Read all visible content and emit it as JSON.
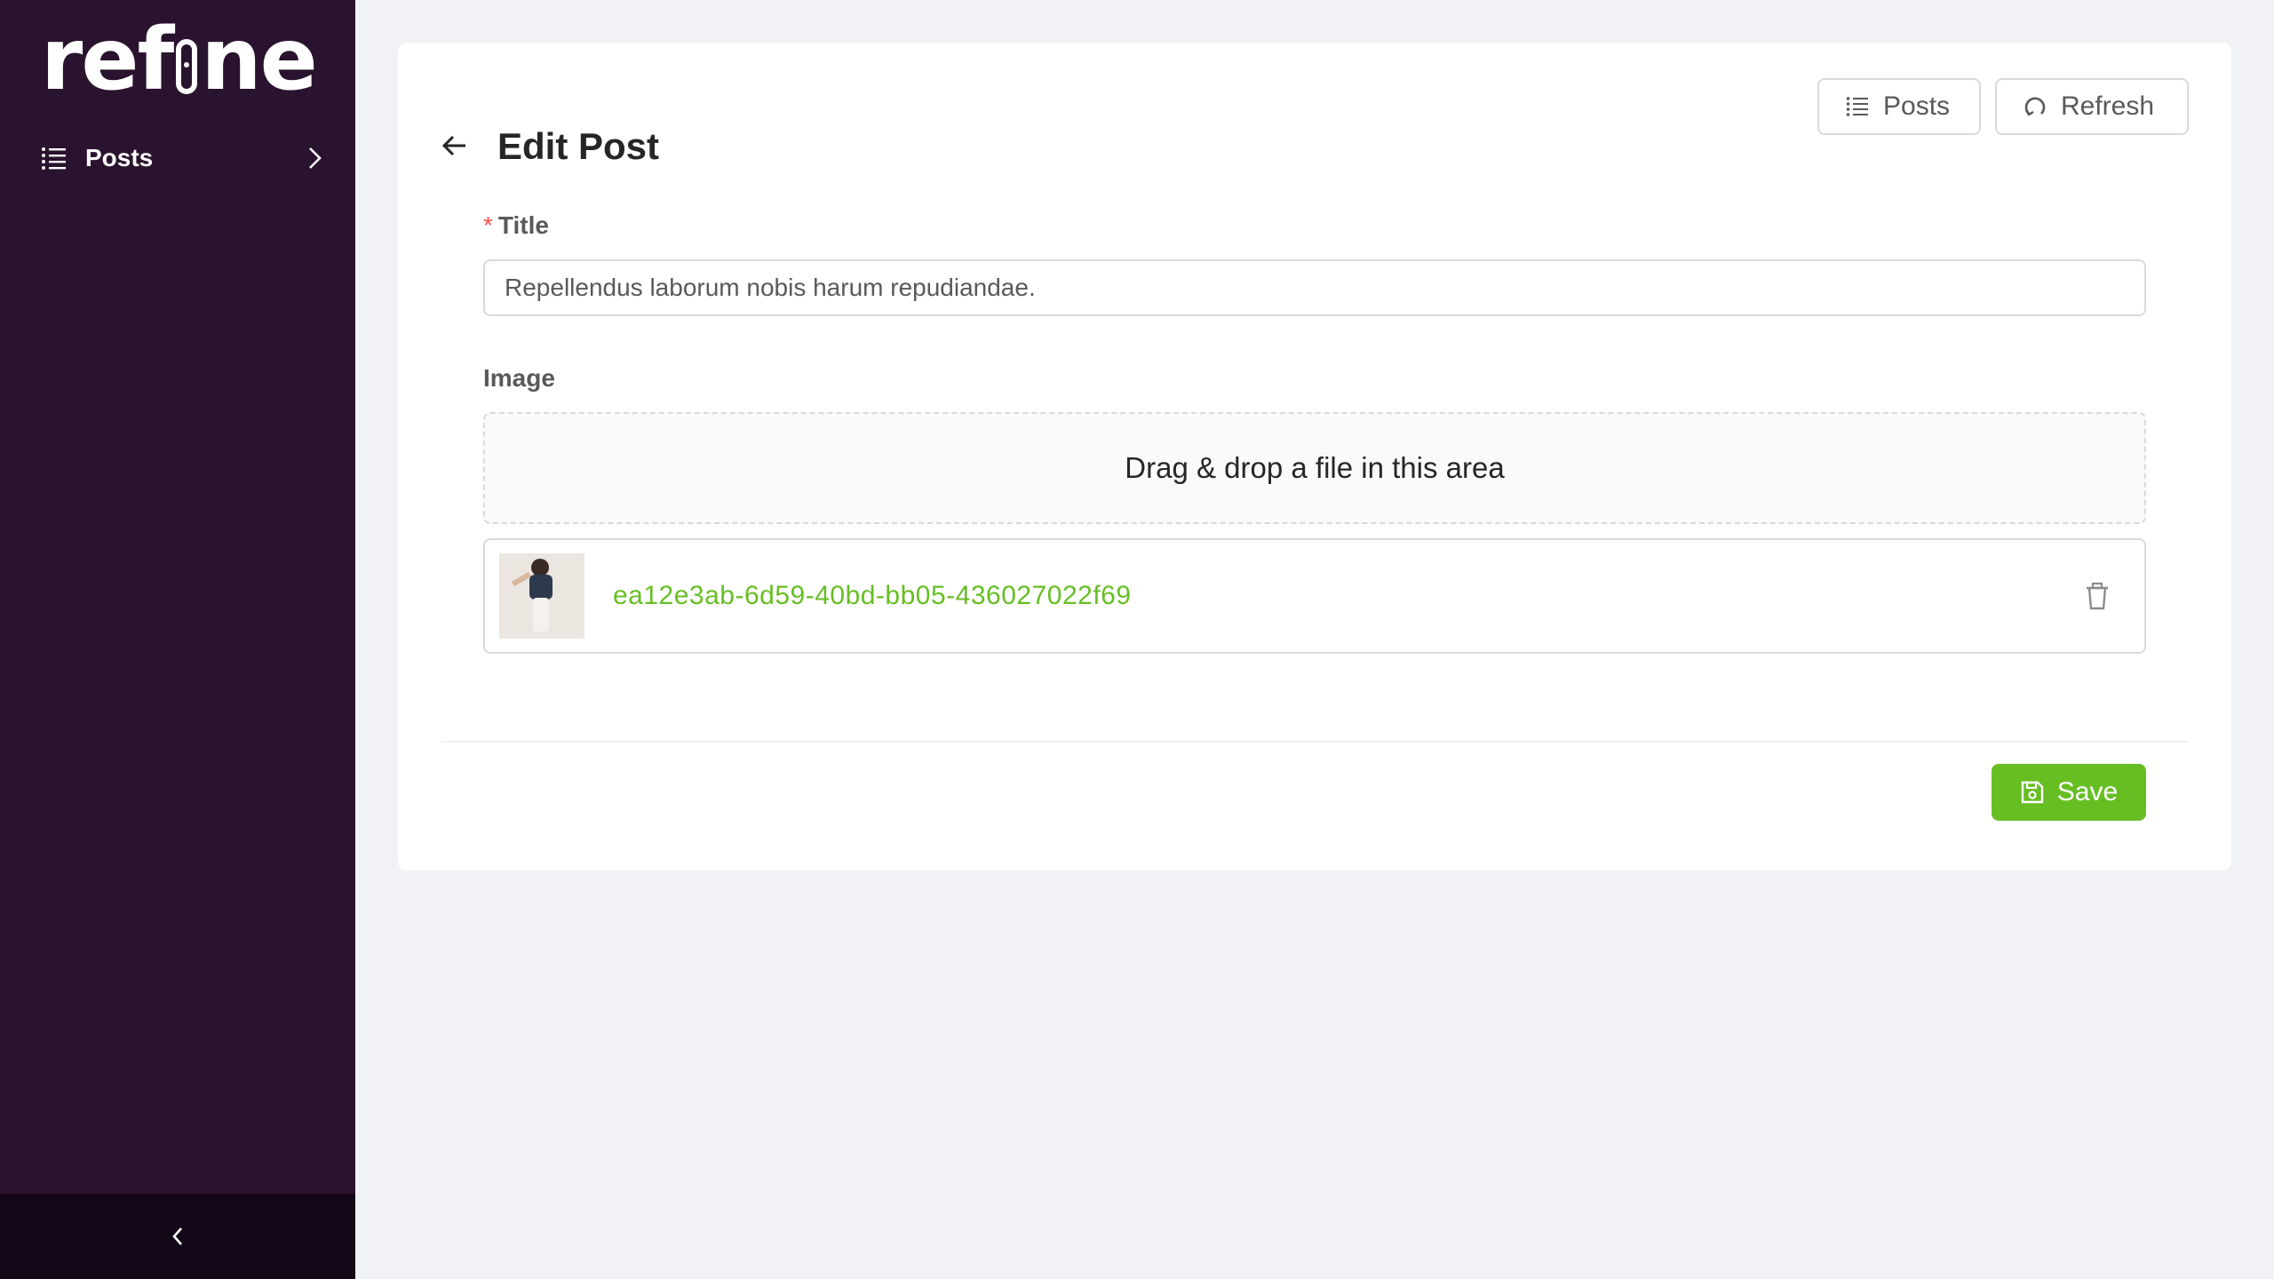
{
  "sidebar": {
    "logo_text_pre": "ref",
    "logo_text_post": "ne",
    "items": [
      {
        "label": "Posts",
        "icon": "list-icon"
      }
    ],
    "collapse_icon": "chevron-left-icon",
    "background": "#2a132e"
  },
  "header": {
    "title": "Edit Post",
    "back_icon": "arrow-left-icon",
    "posts_button_label": "Posts",
    "refresh_button_label": "Refresh"
  },
  "form": {
    "title_label": "Title",
    "title_required_marker": "*",
    "title_value": "Repellendus laborum nobis harum repudiandae.",
    "image_label": "Image",
    "dropzone_text": "Drag & drop a file in this area",
    "file": {
      "name": "ea12e3ab-6d59-40bd-bb05-436027022f69",
      "icon": "trash-icon"
    }
  },
  "footer": {
    "save_label": "Save"
  },
  "colors": {
    "accent": "#67be23",
    "required": "#ff4d4f",
    "page_bg": "#f0f2f5"
  }
}
